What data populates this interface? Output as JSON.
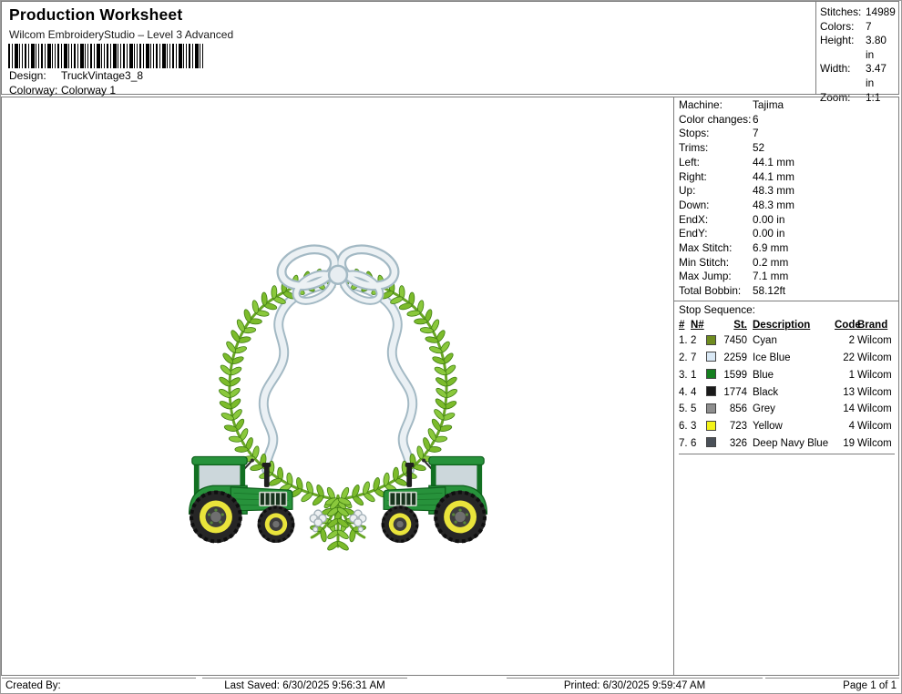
{
  "header": {
    "title": "Production Worksheet",
    "subtitle": "Wilcom EmbroideryStudio – Level 3 Advanced",
    "design_label": "Design:",
    "design_value": "TruckVintage3_8",
    "colorway_label": "Colorway:",
    "colorway_value": "Colorway 1"
  },
  "stats": {
    "rows": [
      {
        "label": "Stitches:",
        "value": "14989"
      },
      {
        "label": "Colors:",
        "value": "7"
      },
      {
        "label": "Height:",
        "value": "3.80 in"
      },
      {
        "label": "Width:",
        "value": "3.47 in"
      },
      {
        "label": "Zoom:",
        "value": "1:1"
      }
    ]
  },
  "machine_info": {
    "rows": [
      {
        "label": "Machine:",
        "value": "Tajima"
      },
      {
        "label": "Color changes:",
        "value": "6"
      },
      {
        "label": "Stops:",
        "value": "7"
      },
      {
        "label": "Trims:",
        "value": "52"
      },
      {
        "label": "Left:",
        "value": "44.1 mm"
      },
      {
        "label": "Right:",
        "value": "44.1 mm"
      },
      {
        "label": "Up:",
        "value": "48.3 mm"
      },
      {
        "label": "Down:",
        "value": "48.3 mm"
      },
      {
        "label": "EndX:",
        "value": "0.00 in"
      },
      {
        "label": "EndY:",
        "value": "0.00 in"
      },
      {
        "label": "Max Stitch:",
        "value": "6.9 mm"
      },
      {
        "label": "Min Stitch:",
        "value": "0.2 mm"
      },
      {
        "label": "Max Jump:",
        "value": "7.1 mm"
      },
      {
        "label": "Total Bobbin:",
        "value": "58.12ft"
      }
    ]
  },
  "stop_sequence": {
    "title": "Stop Sequence:",
    "columns": [
      "#",
      "N#",
      "St.",
      "Description",
      "Code",
      "Brand"
    ],
    "rows": [
      {
        "num": "1.",
        "n": "2",
        "swatch": "#6f8c1f",
        "st": "7450",
        "description": "Cyan",
        "code": "2",
        "brand": "Wilcom"
      },
      {
        "num": "2.",
        "n": "7",
        "swatch": "#d9e8f5",
        "st": "2259",
        "description": "Ice Blue",
        "code": "22",
        "brand": "Wilcom"
      },
      {
        "num": "3.",
        "n": "1",
        "swatch": "#15801f",
        "st": "1599",
        "description": "Blue",
        "code": "1",
        "brand": "Wilcom"
      },
      {
        "num": "4.",
        "n": "4",
        "swatch": "#1a1a1a",
        "st": "1774",
        "description": "Black",
        "code": "13",
        "brand": "Wilcom"
      },
      {
        "num": "5.",
        "n": "5",
        "swatch": "#8e8e8e",
        "st": "856",
        "description": "Grey",
        "code": "14",
        "brand": "Wilcom"
      },
      {
        "num": "6.",
        "n": "3",
        "swatch": "#f3f318",
        "st": "723",
        "description": "Yellow",
        "code": "4",
        "brand": "Wilcom"
      },
      {
        "num": "7.",
        "n": "6",
        "swatch": "#4a5058",
        "st": "326",
        "description": "Deep Navy Blue",
        "code": "19",
        "brand": "Wilcom"
      }
    ]
  },
  "footer": {
    "created_by": "Created By:",
    "last_saved": "Last Saved: 6/30/2025 9:56:31 AM",
    "printed": "Printed: 6/30/2025 9:59:47 AM",
    "page": "Page 1 of 1"
  },
  "design_preview": {
    "description": "Laurel shield wreath with ice-blue bow and ribbon, two green tractors at base",
    "palette": {
      "leaf_green": "#7cbb2b",
      "leaf_green_light": "#8ac83c",
      "leaf_outline": "#3f7d12",
      "stem_green": "#68a625",
      "ribbon_light": "#eaf0f4",
      "ribbon_shade": "#a3b9c4",
      "tractor_green": "#27923b",
      "tractor_green_dark": "#0d5f1b",
      "rim_yellow": "#e9e43b",
      "tire_black": "#262626",
      "window_grey": "#ccd7db"
    }
  }
}
